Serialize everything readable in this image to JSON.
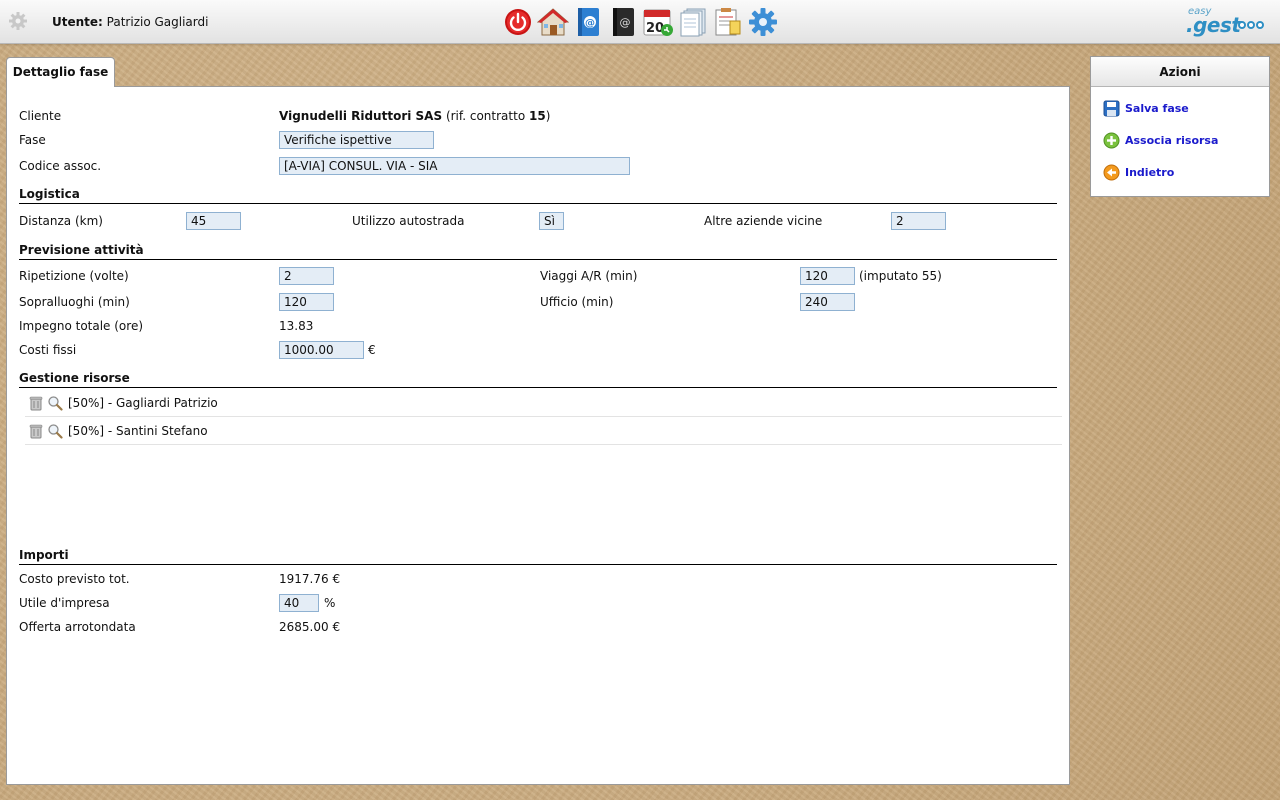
{
  "header": {
    "user_label": "Utente:",
    "user_name": "Patrizio Gagliardi",
    "toolbar_icons": [
      "power-icon",
      "home-icon",
      "contacts-book-icon",
      "address-book-icon",
      "calendar-icon",
      "documents-icon",
      "notes-icon",
      "settings-gear-icon"
    ],
    "calendar_day": "20",
    "logo_small": "easy",
    "logo_big": ".gest"
  },
  "tab": {
    "label": "Dettaglio fase"
  },
  "detail": {
    "cliente_label": "Cliente",
    "cliente_name": "Vignudelli Riduttori SAS",
    "cliente_rif_prefix": "(rif. contratto",
    "cliente_rif_number": "15",
    "cliente_rif_suffix": ")",
    "fase_label": "Fase",
    "fase_value": "Verifiche ispettive",
    "codice_label": "Codice assoc.",
    "codice_value": "[A-VIA] CONSUL. VIA - SIA"
  },
  "logistica": {
    "title": "Logistica",
    "distanza_label": "Distanza (km)",
    "distanza_value": "45",
    "autostrada_label": "Utilizzo autostrada",
    "autostrada_value": "Sì",
    "aziende_label": "Altre aziende vicine",
    "aziende_value": "2"
  },
  "previsione": {
    "title": "Previsione attività",
    "ripetizione_label": "Ripetizione (volte)",
    "ripetizione_value": "2",
    "viaggi_label": "Viaggi A/R (min)",
    "viaggi_value": "120",
    "viaggi_note": "(imputato 55)",
    "sopralluoghi_label": "Sopralluoghi (min)",
    "sopralluoghi_value": "120",
    "ufficio_label": "Ufficio (min)",
    "ufficio_value": "240",
    "impegno_label": "Impegno totale (ore)",
    "impegno_value": "13.83",
    "costi_label": "Costi fissi",
    "costi_value": "1000.00",
    "costi_unit": "€"
  },
  "risorse": {
    "title": "Gestione risorse",
    "items": [
      {
        "text": "[50%] - Gagliardi Patrizio"
      },
      {
        "text": "[50%] - Santini Stefano"
      }
    ]
  },
  "importi": {
    "title": "Importi",
    "costo_label": "Costo previsto tot.",
    "costo_value": "1917.76 €",
    "utile_label": "Utile d'impresa",
    "utile_value": "40",
    "utile_unit": "%",
    "offerta_label": "Offerta arrotondata",
    "offerta_value": "2685.00 €"
  },
  "actions": {
    "title": "Azioni",
    "items": [
      {
        "label": "Salva fase",
        "icon": "floppy-disk-icon"
      },
      {
        "label": "Associa risorsa",
        "icon": "plus-circle-icon"
      },
      {
        "label": "Indietro",
        "icon": "back-arrow-icon"
      }
    ]
  },
  "colors": {
    "link": "#1a1acc",
    "input_bg": "#e4edf6",
    "input_border": "#8fb1d1",
    "background": "#c9ab7f"
  }
}
